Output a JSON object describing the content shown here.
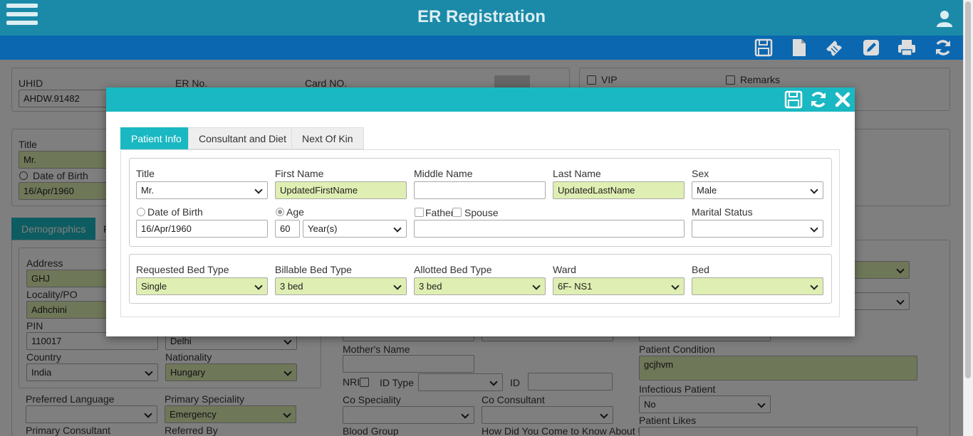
{
  "header": {
    "title": "ER Registration"
  },
  "toolbar": {
    "icons": [
      "save-icon",
      "new-document-icon",
      "ticket-icon",
      "edit-icon",
      "print-icon",
      "refresh-icon"
    ]
  },
  "background": {
    "uhid_label": "UHID",
    "uhid_value": "AHDW.91482",
    "er_no_label": "ER No.",
    "card_no_label": "Card NO.",
    "vip_label": "VIP",
    "remarks_label": "Remarks",
    "title_label": "Title",
    "title_value": "Mr.",
    "dob_label": "Date of Birth",
    "dob_value": "16/Apr/1960",
    "tab_demographics": "Demographics",
    "tab_partial": "P",
    "address_label": "Address",
    "address_value": "GHJ",
    "locality_label": "Locality/PO",
    "locality_value": "Adhchini",
    "pin_label": "PIN",
    "pin_value": "110017",
    "state_value": "Delhi",
    "country_label": "Country",
    "country_value": "India",
    "nationality_label": "Nationality",
    "nationality_value": "Hungary",
    "pref_lang_label": "Preferred Language",
    "pref_lang_value": "",
    "primary_spec_label": "Primary Speciality",
    "primary_spec_value": "Emergency",
    "primary_consultant_label": "Primary Consultant",
    "referred_by_label": "Referred By",
    "mothers_name_label": "Mother's Name",
    "nri_label": "NRI",
    "id_type_label": "ID Type",
    "id_label": "ID",
    "co_spec_label": "Co Speciality",
    "co_consultant_label": "Co Consultant",
    "blood_group_label": "Blood Group",
    "how_label": "How Did You Come to Know About Us",
    "condition_label": "Patient Condition",
    "condition_value": "gcjhvm",
    "infectious_label": "Infectious Patient",
    "infectious_value": "No",
    "likes_label": "Patient Likes"
  },
  "modal": {
    "tabs": [
      "Patient Info",
      "Consultant and Diet",
      "Next Of Kin"
    ],
    "title_label": "Title",
    "title_value": "Mr.",
    "first_name_label": "First Name",
    "first_name_value": "UpdatedFirstName",
    "middle_name_label": "Middle Name",
    "middle_name_value": "",
    "last_name_label": "Last Name",
    "last_name_value": "UpdatedLastName",
    "sex_label": "Sex",
    "sex_value": "Male",
    "dob_label": "Date of Birth",
    "dob_value": "16/Apr/1960",
    "age_label": "Age",
    "age_value": "60",
    "age_unit_value": "Year(s)",
    "father_label": "Father",
    "spouse_label": "Spouse",
    "relation_value": "",
    "marital_label": "Marital Status",
    "marital_value": "",
    "req_bed_label": "Requested Bed Type",
    "req_bed_value": "Single",
    "bill_bed_label": "Billable Bed Type",
    "bill_bed_value": "3 bed",
    "allot_bed_label": "Allotted Bed Type",
    "allot_bed_value": "3 bed",
    "ward_label": "Ward",
    "ward_value": "6F- NS1",
    "bed_label": "Bed",
    "bed_value": ""
  },
  "colors": {
    "header": "#1a8aa8",
    "toolbar": "#0b67b0",
    "modal_header": "#1ab8c2",
    "field_highlight": "#dfeeb2"
  }
}
